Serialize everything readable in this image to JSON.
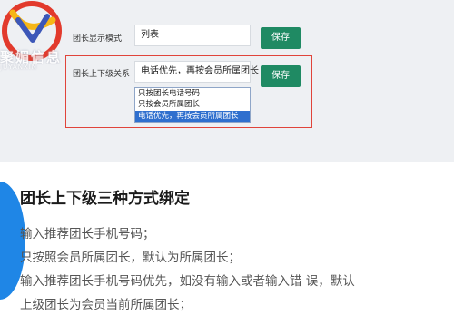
{
  "logo": {
    "text": "聚媚信息",
    "subtext": "JUYANXIN"
  },
  "settings": {
    "row1": {
      "label": "团长显示模式",
      "value": "列表",
      "save_label": "保存"
    },
    "row2": {
      "label": "团长上下级关系",
      "value": "电话优先，再按会员所属团长",
      "save_label": "保存",
      "options": [
        "只按团长电话号码",
        "只按会员所属团长",
        "电话优先，再按会员所属团长"
      ],
      "selected_index": 2
    }
  },
  "article": {
    "heading": "团长上下级三种方式绑定",
    "lines": [
      "输入推荐团长手机号码；",
      "只按照会员所属团长，默认为所属团长；",
      "输入推荐团长手机号码优先，如没有输入或者输入错 误，默认",
      "上级团长为会员当前所属团长；"
    ]
  },
  "colors": {
    "accent": "#1f8a63",
    "highlight": "#e0443a",
    "selected": "#2f6fce",
    "decor": "#1f86e6"
  }
}
